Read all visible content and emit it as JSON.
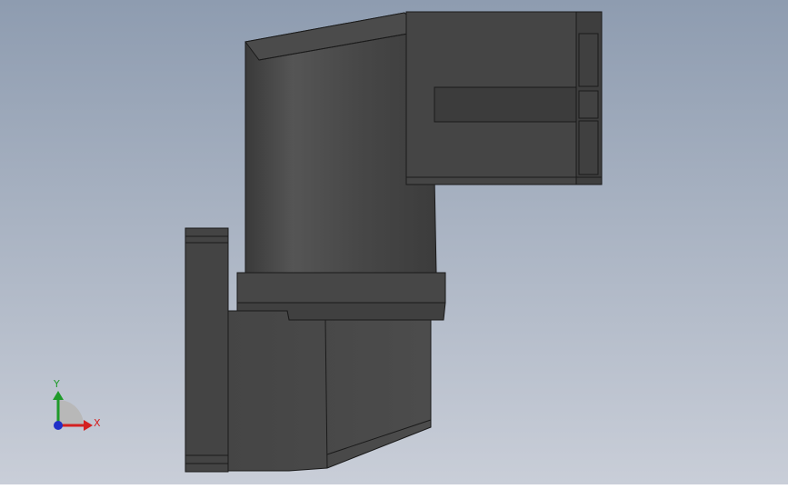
{
  "colors": {
    "background_top": "#8e9cb0",
    "background_bottom": "#c7ccd6",
    "part_dark": "#3e3e3e",
    "part_mid": "#4a4a4a",
    "part_light": "#555555",
    "edge": "#1a1a1a",
    "axis_x": "#d42020",
    "axis_y": "#1f9a2a",
    "axis_z": "#2030c8"
  },
  "triad": {
    "x_label": "X",
    "y_label": "Y"
  }
}
